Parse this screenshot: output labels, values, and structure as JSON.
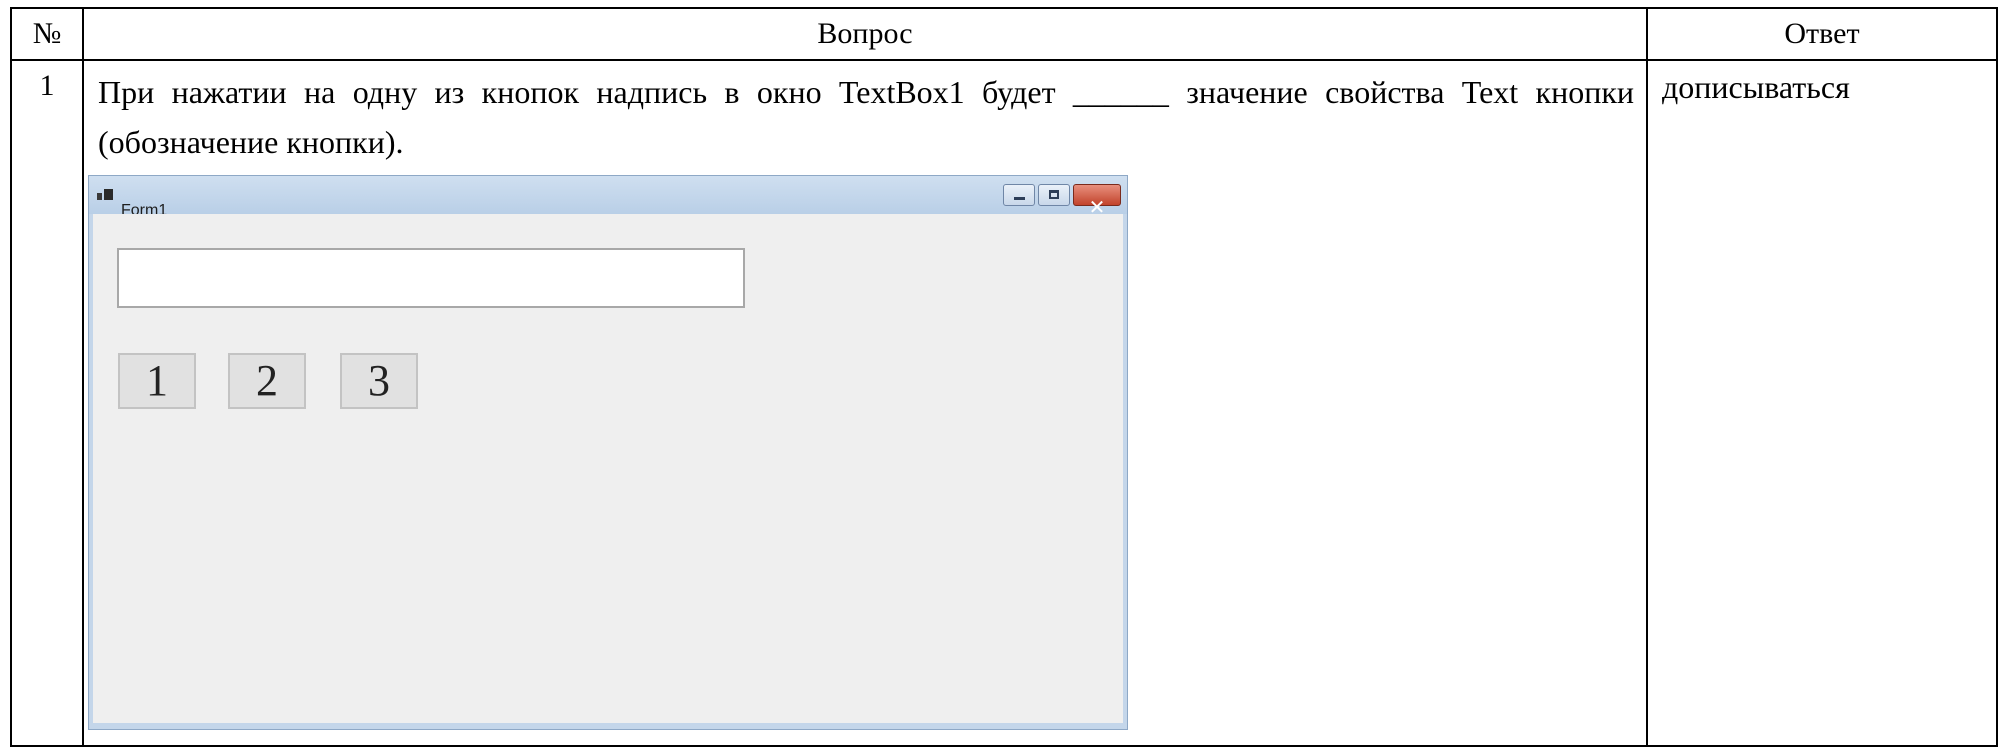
{
  "table": {
    "header": {
      "num": "№",
      "question": "Вопрос",
      "answer": "Ответ"
    },
    "rows": [
      {
        "num": "1",
        "question": "При нажатии на одну из кнопок надпись в окно TextBox1 будет ______ значение свойства Text кнопки (обозначение кнопки).",
        "answer": "дописываться"
      }
    ]
  },
  "form": {
    "title": "Form1",
    "textbox_value": "",
    "buttons": [
      "1",
      "2",
      "3"
    ],
    "close_glyph": "✕"
  }
}
